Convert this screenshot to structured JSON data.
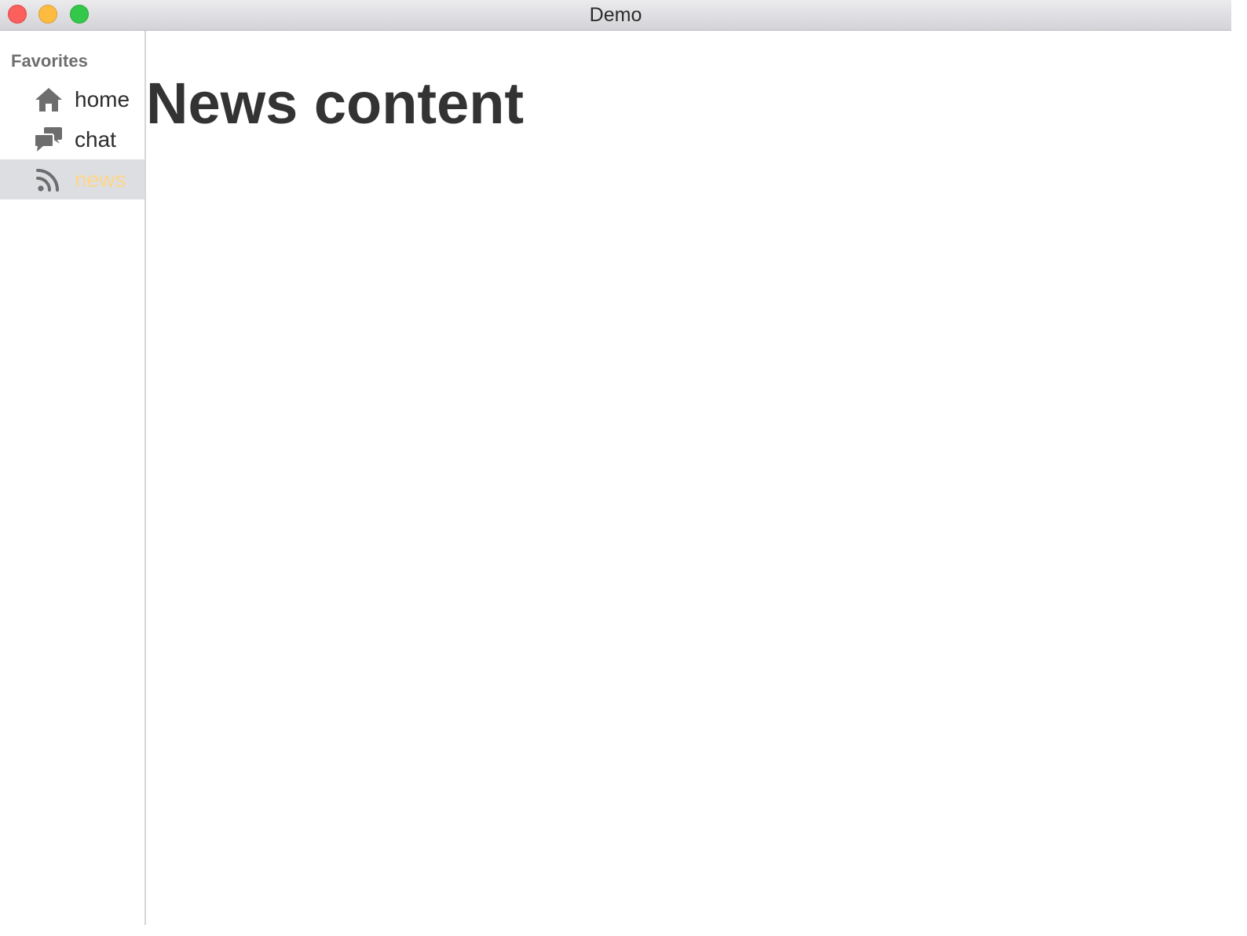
{
  "window": {
    "title": "Demo"
  },
  "sidebar": {
    "section_title": "Favorites",
    "items": [
      {
        "label": "home",
        "icon": "home-icon",
        "active": false
      },
      {
        "label": "chat",
        "icon": "chat-icon",
        "active": false
      },
      {
        "label": "news",
        "icon": "rss-icon",
        "active": true
      }
    ]
  },
  "main": {
    "heading": "News content"
  },
  "colors": {
    "active_item_background": "#dcdee1",
    "active_item_label": "#fdd68a",
    "icon": "#6d6d6d",
    "heading": "#333333"
  }
}
